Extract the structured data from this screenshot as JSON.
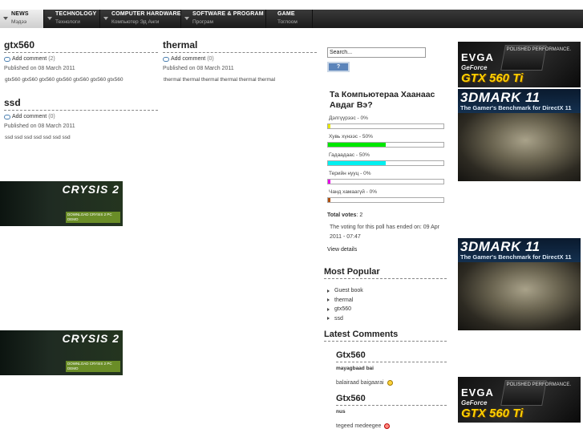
{
  "nav": {
    "items": [
      {
        "title": "NEWS",
        "sub": "Мэдээ",
        "active": true
      },
      {
        "title": "TECHNOLOGY",
        "sub": "Технологи",
        "active": false
      },
      {
        "title": "COMPUTER HARDWARE",
        "sub": "Компьютер Эд Анги",
        "active": false
      },
      {
        "title": "SOFTWARE & PROGRAM",
        "sub": "Програм",
        "active": false
      },
      {
        "title": "GAME",
        "sub": "Тоглоом",
        "active": false
      }
    ]
  },
  "articles": [
    {
      "title": "gtx560",
      "comment_label": "Add comment",
      "comment_count": "(2)",
      "date": "Published on 08 March 2011",
      "body": "gtx560 gtx560 gtx560 gtx560 gtx560 gtx560 gtx560"
    },
    {
      "title": "thermal",
      "comment_label": "Add comment",
      "comment_count": "(0)",
      "date": "Published on 08 March 2011",
      "body": "thermal thermal thermal thermal thermal thermal"
    },
    {
      "title": "ssd",
      "comment_label": "Add comment",
      "comment_count": "(0)",
      "date": "Published on 08 March 2011",
      "body": "ssd ssd ssd ssd ssd ssd ssd"
    }
  ],
  "search": {
    "placeholder": "Search...",
    "value": "Search...",
    "button": "?"
  },
  "poll": {
    "question": "Та Компьютераа Хаанаас Авдаг Вэ?",
    "options": [
      {
        "label": "Дэлгүүрээс - 0%",
        "percent": 2,
        "color": "#e8e800"
      },
      {
        "label": "Хувь хүнээс - 50%",
        "percent": 50,
        "color": "#00e800"
      },
      {
        "label": "Гадаадаас - 50%",
        "percent": 50,
        "color": "#00f0f0"
      },
      {
        "label": "Терийн нууц - 0%",
        "percent": 2,
        "color": "#e800e8"
      },
      {
        "label": "Чанд хамаагүй - 0%",
        "percent": 2,
        "color": "#b05010"
      }
    ],
    "total_label": "Total votes",
    "total_value": ": 2",
    "ended": "The voting for this poll has ended on: 09 Apr 2011 - 07:47",
    "details": "View details"
  },
  "popular": {
    "title": "Most Popular",
    "items": [
      "Guest book",
      "thermal",
      "gtx560",
      "ssd"
    ]
  },
  "latest_comments": {
    "title": "Latest Comments",
    "items": [
      {
        "title": "Gtx560",
        "author": "mayagbaad bai",
        "text": "balairaad baigaarai",
        "smiley": "yellow"
      },
      {
        "title": "Gtx560",
        "author": "nus",
        "text": "tegeed medeegee",
        "smiley": "red"
      }
    ]
  },
  "ads": {
    "evga": {
      "logo": "EVGA",
      "brand": "GeForce",
      "model": "GTX 560 Ti",
      "tag": "POLISHED PERFORMANCE."
    },
    "mark": {
      "logo": "3DMARK 11",
      "sub": "The Gamer's Benchmark for DirectX 11"
    },
    "crysis": {
      "logo": "CRYSIS 2",
      "bar": "DOWNLOAD CRYSIS 2 PC DEMO"
    }
  }
}
